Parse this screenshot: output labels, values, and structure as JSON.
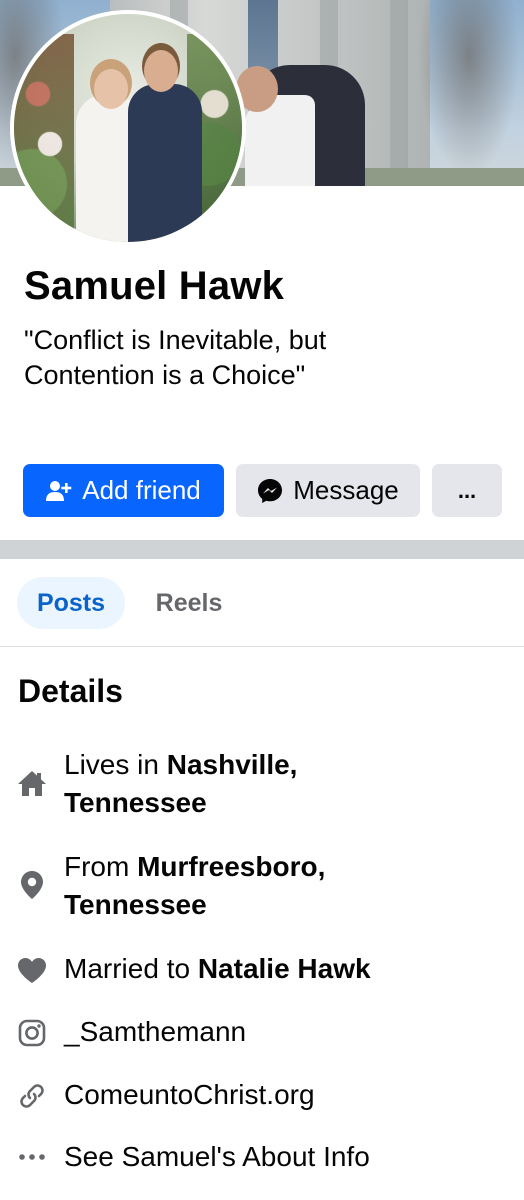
{
  "profile": {
    "name": "Samuel Hawk",
    "bio_line1": "\"Conflict is Inevitable, but",
    "bio_line2": "Contention is a Choice\""
  },
  "actions": {
    "add_friend": "Add friend",
    "message": "Message",
    "more": "..."
  },
  "tabs": [
    {
      "label": "Posts",
      "active": true
    },
    {
      "label": "Reels",
      "active": false
    }
  ],
  "details": {
    "title": "Details",
    "lives_prefix": "Lives in",
    "lives_place_1": "Nashville,",
    "lives_place_2": "Tennessee",
    "from_prefix": "From",
    "from_place_1": "Murfreesboro,",
    "from_place_2": "Tennessee",
    "married_prefix": "Married to",
    "married_name": "Natalie Hawk",
    "instagram": "_Samthemann",
    "website": "ComeuntoChrist.org",
    "about": "See Samuel's About Info"
  },
  "icons": {
    "home": "home-icon",
    "location": "location-pin-icon",
    "relationship": "heart-icon",
    "instagram": "instagram-icon",
    "website": "link-icon",
    "about": "more-dots-icon"
  },
  "colors": {
    "accent": "#0866ff",
    "button_gray": "#e4e6eb",
    "tab_active_bg": "#ebf5ff",
    "tab_active_text": "#0a64c8",
    "icon_gray": "#65676b"
  }
}
